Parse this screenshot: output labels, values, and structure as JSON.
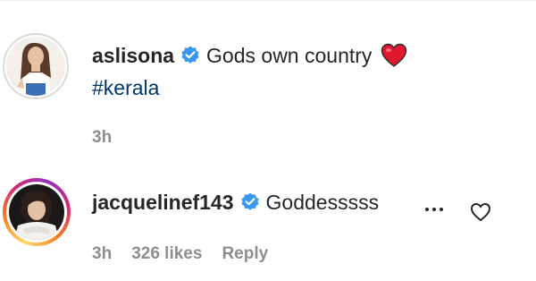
{
  "comments": [
    {
      "username": "aslisona",
      "verified": true,
      "text": "Gods own country",
      "emoji": "heart",
      "hashtag": "#kerala",
      "time": "3h"
    },
    {
      "username": "jacquelinef143",
      "verified": true,
      "text": "Goddesssss",
      "time": "3h",
      "likes": "326 likes",
      "reply_label": "Reply"
    }
  ],
  "colors": {
    "text": "#262626",
    "muted": "#8e8e8e",
    "link": "#00376b",
    "verified": "#3897f0",
    "heart": "#ed4956"
  },
  "icons": {
    "verified": "verified-badge-icon",
    "heart_emoji": "red-heart-emoji-icon",
    "more": "more-options-icon",
    "like": "heart-outline-icon"
  }
}
